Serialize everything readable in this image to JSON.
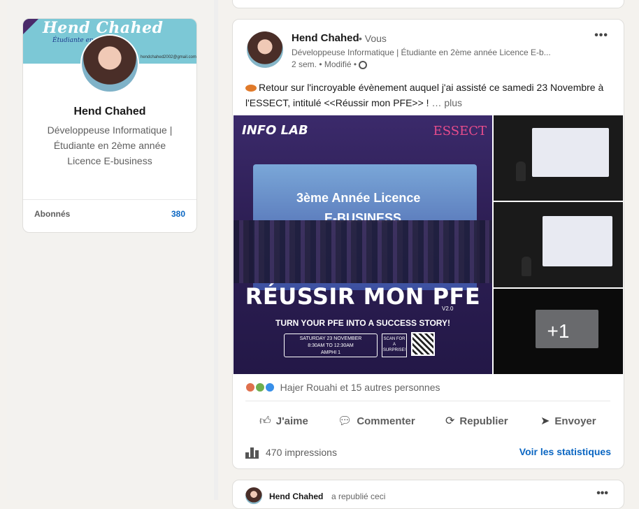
{
  "profile": {
    "banner_title": "Hend Chahed",
    "banner_subtitle": "Étudiante en",
    "banner_email": "hendchahed2002@gmail.com",
    "name": "Hend Chahed",
    "headline": "Développeuse Informatique | Étudiante en 2ème année Licence E-business",
    "followers_label": "Abonnés",
    "followers_count": "380"
  },
  "post": {
    "author": "Hend Chahed",
    "you_label": "• Vous",
    "headline": "Développeuse Informatique | Étudiante en 2ème année Licence E-b...",
    "time": "2 sem. • Modifié •",
    "text": "Retour sur l'incroyable évènement auquel j'ai assisté ce samedi 23 Novembre à l'ESSECT, intitulé <<Réussir mon PFE>> !",
    "more_link": "… plus",
    "reactions_text": "Hajer Rouahi et 15 autres personnes",
    "actions": {
      "like": "J'aime",
      "comment": "Commenter",
      "repost": "Republier",
      "send": "Envoyer"
    },
    "impressions": "470 impressions",
    "stats_link": "Voir les statistiques",
    "more_photos": "+1"
  },
  "media": {
    "logo": "INFO LAB",
    "essect": "ESSECT",
    "screen_line1": "3ème Année Licence",
    "screen_line2": "E-BUSINESS",
    "big_title": "RÉUSSIR MON PFE",
    "version": "V2.0",
    "subtitle": "TURN YOUR PFE INTO A SUCCESS STORY!",
    "date_line1": "SATURDAY 23 NOVEMBER",
    "date_line2": "8:30AM TO 12:30AM",
    "date_line3": "AMPHI 1",
    "scan": "SCAN FOR A SURPRISE!"
  },
  "repost": {
    "name": "Hend Chahed",
    "text": "a republié ceci"
  },
  "icons": [
    "more-icon",
    "globe-icon",
    "planet-icon",
    "like-icon",
    "comment-icon",
    "repost-icon",
    "send-icon",
    "bars-icon"
  ]
}
